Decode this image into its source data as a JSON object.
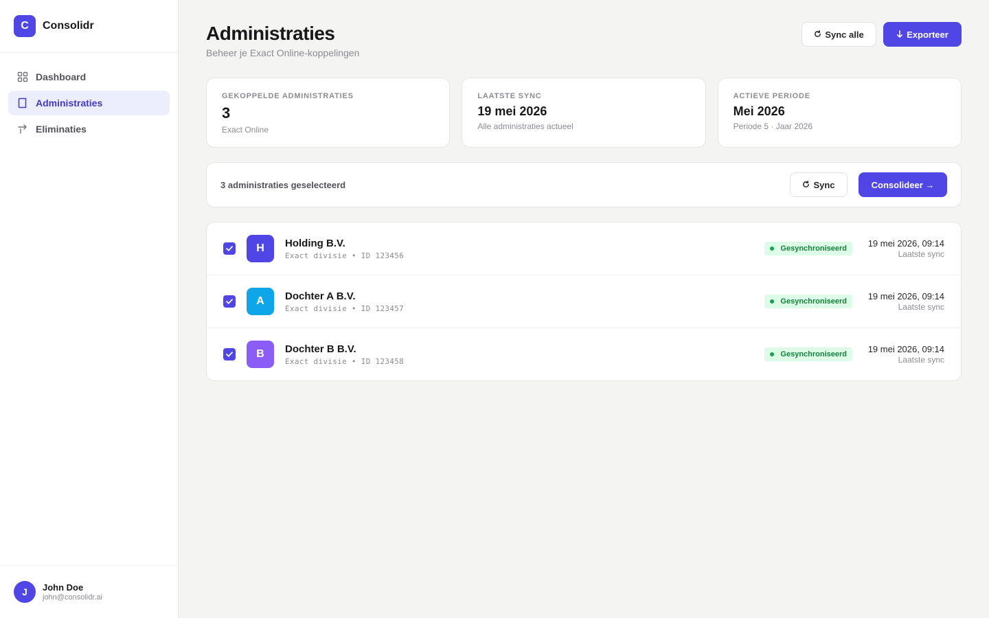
{
  "brand": {
    "logo_letter": "C",
    "name": "Consolidr"
  },
  "sidebar": {
    "items": [
      {
        "label": "Dashboard",
        "icon": "grid-icon",
        "active": false
      },
      {
        "label": "Administraties",
        "icon": "book-icon",
        "active": true
      },
      {
        "label": "Eliminaties",
        "icon": "arrows-icon",
        "active": false
      }
    ]
  },
  "user": {
    "initial": "J",
    "name": "John Doe",
    "email": "john@consolidr.ai"
  },
  "header": {
    "title": "Administraties",
    "subtitle": "Beheer je Exact Online-koppelingen",
    "sync_all_label": "Sync alle",
    "export_label": "Exporteer"
  },
  "stats": [
    {
      "label": "GEKOPPELDE ADMINISTRATIES",
      "value": "3",
      "sub": "Exact Online"
    },
    {
      "label": "LAATSTE SYNC",
      "value": "19 mei 2026",
      "sub": "Alle administraties actueel"
    },
    {
      "label": "ACTIEVE PERIODE",
      "value": "Mei 2026",
      "sub": "Periode 5 · Jaar 2026"
    }
  ],
  "toolbar": {
    "selection_text": "3 administraties geselecteerd",
    "sync_label": "Sync",
    "consolidate_label": "Consolideer →"
  },
  "colors": {
    "accent": "#4f46e5",
    "status_bg": "#dcfce7",
    "status_text": "#15803d"
  },
  "administrations": [
    {
      "initial": "H",
      "color": "#4f46e5",
      "name": "Holding B.V.",
      "meta": "Exact divisie • ID 123456",
      "status": "Gesynchroniseerd",
      "sync_date": "19 mei 2026, 09:14",
      "sync_label": "Laatste sync",
      "checked": true
    },
    {
      "initial": "A",
      "color": "#0ea5e9",
      "name": "Dochter A B.V.",
      "meta": "Exact divisie • ID 123457",
      "status": "Gesynchroniseerd",
      "sync_date": "19 mei 2026, 09:14",
      "sync_label": "Laatste sync",
      "checked": true
    },
    {
      "initial": "B",
      "color": "#8b5cf6",
      "name": "Dochter B B.V.",
      "meta": "Exact divisie • ID 123458",
      "status": "Gesynchroniseerd",
      "sync_date": "19 mei 2026, 09:14",
      "sync_label": "Laatste sync",
      "checked": true
    }
  ]
}
